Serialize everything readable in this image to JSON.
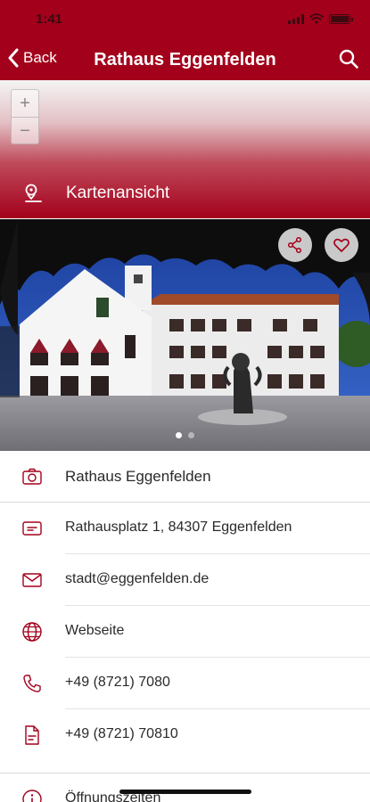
{
  "status_bar": {
    "time": "1:41"
  },
  "nav": {
    "back_label": "Back",
    "title": "Rathaus Eggenfelden"
  },
  "map": {
    "zoom_in": "+",
    "zoom_out": "−",
    "link_label": "Kartenansicht"
  },
  "gallery": {
    "slides": 2,
    "active_slide": 1
  },
  "details": {
    "name": "Rathaus Eggenfelden",
    "address": "Rathausplatz 1, 84307 Eggenfelden",
    "email": "stadt@eggenfelden.de",
    "website": "Webseite",
    "phone": "+49 (8721) 7080",
    "fax": "+49 (8721) 70810",
    "opening_hours": "Öffnungszeiten"
  },
  "icons": {
    "back": "chevron-left-icon",
    "search": "search-icon",
    "map": "map-pin-icon",
    "share": "share-icon",
    "favorite": "heart-icon",
    "name": "camera-icon",
    "address": "address-card-icon",
    "email": "mail-icon",
    "website": "globe-icon",
    "phone": "phone-icon",
    "fax": "fax-document-icon",
    "opening_hours": "info-icon"
  },
  "colors": {
    "brand": "#a3001b",
    "icon": "#a3001b",
    "text": "#2a2a2a"
  }
}
